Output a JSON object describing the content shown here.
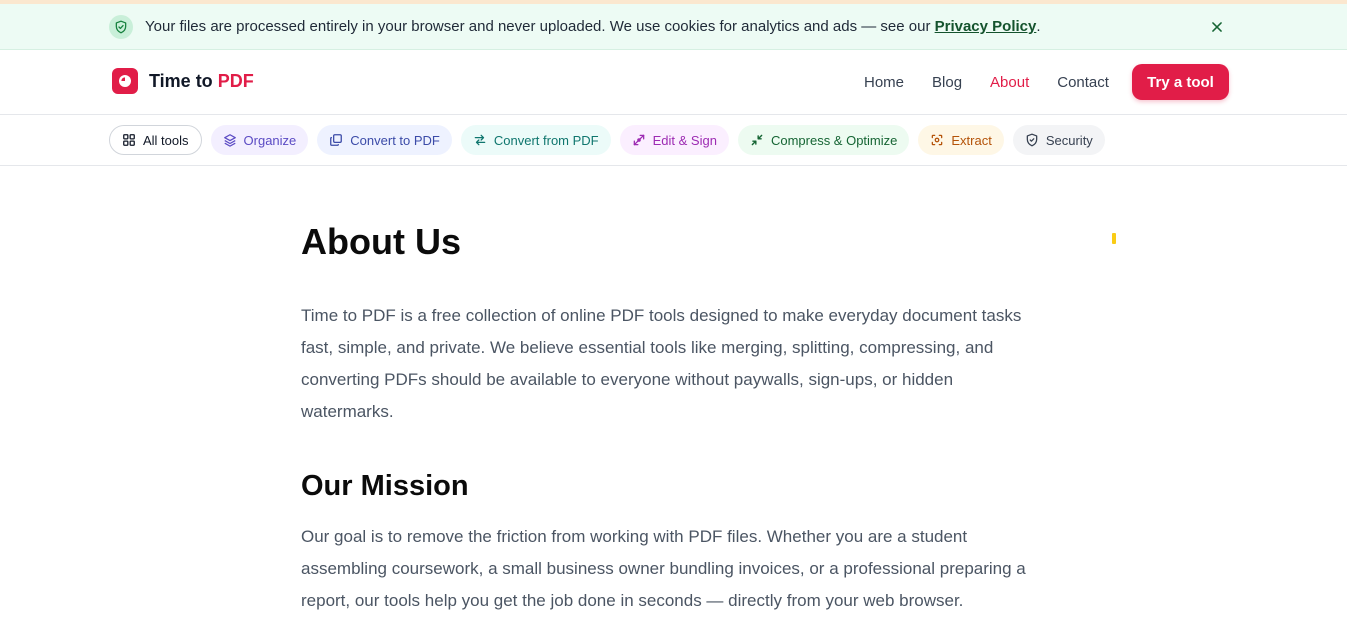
{
  "notice": {
    "text": "Your files are processed entirely in your browser and never uploaded. We use cookies for analytics and ads — see our ",
    "link": "Privacy Policy",
    "tail": ".",
    "icon": "shield-check-icon",
    "close_icon": "close-icon"
  },
  "header": {
    "logo_text": "Time to ",
    "logo_accent": "PDF",
    "nav": [
      {
        "label": "Home",
        "active": false
      },
      {
        "label": "Blog",
        "active": false
      },
      {
        "label": "About",
        "active": true
      },
      {
        "label": "Contact",
        "active": false
      }
    ],
    "cta": "Try a tool"
  },
  "categories": [
    {
      "label": "All tools",
      "icon": "grid-icon"
    },
    {
      "label": "Organize",
      "icon": "layers-icon"
    },
    {
      "label": "Convert to PDF",
      "icon": "copy-icon"
    },
    {
      "label": "Convert from PDF",
      "icon": "swap-arrows-icon"
    },
    {
      "label": "Edit & Sign",
      "icon": "pen-tool-icon"
    },
    {
      "label": "Compress & Optimize",
      "icon": "shrink-icon"
    },
    {
      "label": "Extract",
      "icon": "scan-icon"
    },
    {
      "label": "Security",
      "icon": "shield-icon"
    }
  ],
  "main": {
    "title": "About Us",
    "intro": "Time to PDF is a free collection of online PDF tools designed to make everyday document tasks fast, simple, and private. We believe essential tools like merging, splitting, compressing, and converting PDFs should be available to everyone without paywalls, sign-ups, or hidden watermarks.",
    "mission_title": "Our Mission",
    "mission": "Our goal is to remove the friction from working with PDF files. Whether you are a student assembling coursework, a small business owner bundling invoices, or a professional preparing a report, our tools help you get the job done in seconds — directly from your web browser."
  },
  "colors": {
    "brand": "#e11d48",
    "notice_bg": "#edfbf4",
    "text_body": "#4b5563"
  }
}
